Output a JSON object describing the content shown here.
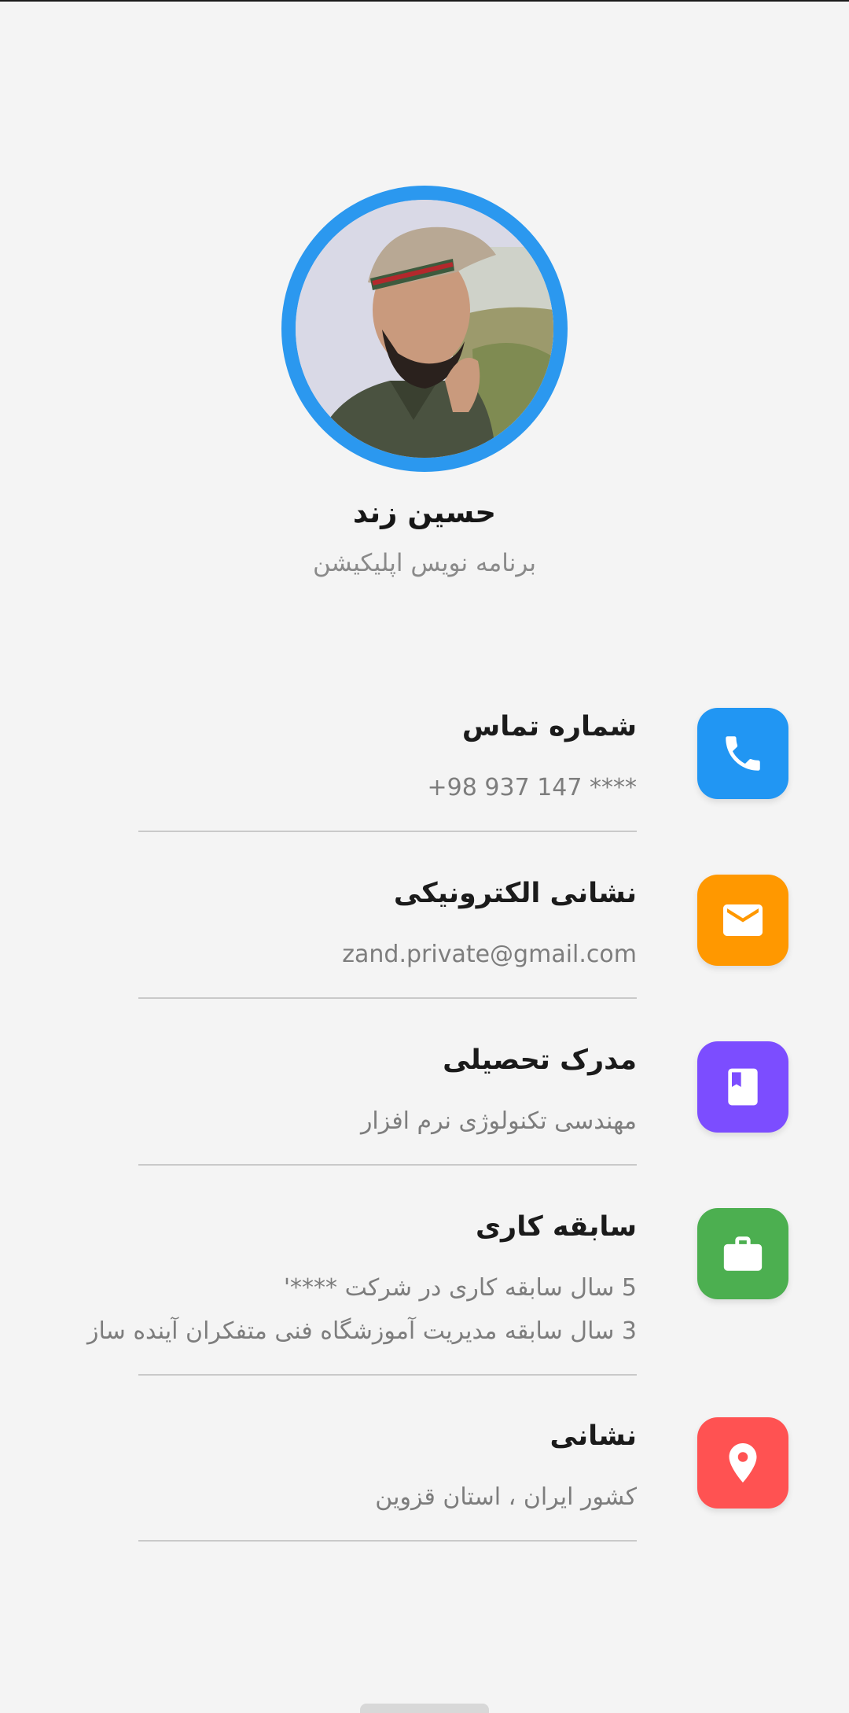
{
  "profile": {
    "name": "حسین زند",
    "title": "برنامه نویس اپلیکیشن"
  },
  "contacts": [
    {
      "icon": "phone-icon",
      "color": "#2196f3",
      "title": "شماره تماس",
      "values": [
        "+98 937 147 ****"
      ]
    },
    {
      "icon": "mail-icon",
      "color": "#ff9800",
      "title": "نشانی الکترونیکی",
      "values": [
        "zand.private@gmail.com"
      ]
    },
    {
      "icon": "book-icon",
      "color": "#7c4dff",
      "title": "مدرک تحصیلی",
      "values": [
        "مهندسی تکنولوژی نرم افزار"
      ]
    },
    {
      "icon": "briefcase-icon",
      "color": "#4caf50",
      "title": "سابقه کاری",
      "values": [
        "5 سال سابقه کاری در شرکت ****'",
        "3 سال سابقه مدیریت آموزشگاه فنی متفکران آینده ساز"
      ]
    },
    {
      "icon": "location-pin-icon",
      "color": "#ff5252",
      "title": "نشانی",
      "values": [
        "کشور ایران ، استان قزوین"
      ]
    }
  ]
}
